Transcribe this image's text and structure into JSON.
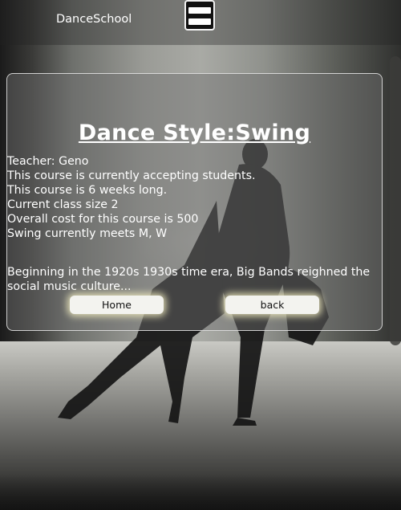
{
  "header": {
    "brand": "DanceSchool",
    "menu_icon": "hamburger-menu-icon"
  },
  "course": {
    "title": "Dance Style:Swing",
    "details": [
      "Teacher: Geno",
      "This course is currently accepting students.",
      "This course is 6 weeks long.",
      "Current class size 2",
      "Overall cost for this course is 500",
      "Swing currently meets M, W"
    ],
    "description": "Beginning in the 1920s 1930s time era, Big Bands reighned the social music culture..."
  },
  "actions": {
    "home_label": "Home",
    "back_label": "back"
  },
  "colors": {
    "text": "#ffffff",
    "button_bg": "#f3f3ef",
    "button_glow": "#f0ebbe"
  }
}
